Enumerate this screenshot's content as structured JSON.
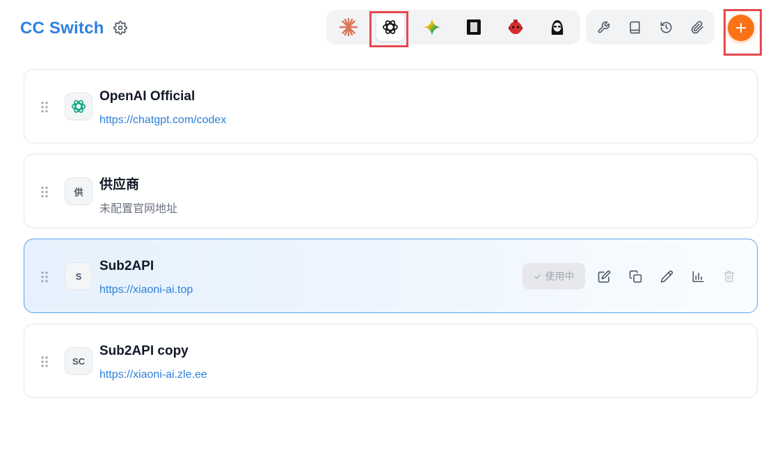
{
  "header": {
    "title": "CC Switch",
    "settings_icon": "gear-icon"
  },
  "app_switcher": [
    {
      "id": "claude",
      "icon": "claude-icon",
      "color": "#d97757",
      "active": false
    },
    {
      "id": "codex",
      "icon": "openai-icon",
      "color": "#111111",
      "active": true
    },
    {
      "id": "gemini",
      "icon": "gemini-icon",
      "color": "#4285f4",
      "active": false
    },
    {
      "id": "app4",
      "icon": "black-square-app-icon",
      "color": "#111111",
      "active": false
    },
    {
      "id": "app5",
      "icon": "red-mascot-icon",
      "color": "#d32f2f",
      "active": false
    },
    {
      "id": "app6",
      "icon": "character-avatar-icon",
      "color": "#111111",
      "active": false
    }
  ],
  "tools": [
    {
      "id": "tools",
      "icon": "wrench-icon"
    },
    {
      "id": "docs",
      "icon": "book-icon"
    },
    {
      "id": "history",
      "icon": "history-icon"
    },
    {
      "id": "attach",
      "icon": "paperclip-icon"
    }
  ],
  "add_button": {
    "icon": "plus-icon",
    "color": "#f97316"
  },
  "providers": [
    {
      "name": "OpenAI Official",
      "url": "https://chatgpt.com/codex",
      "avatar": "",
      "avatar_icon": "openai-icon",
      "url_muted": false,
      "active": false
    },
    {
      "name": "供应商",
      "url": "未配置官网地址",
      "avatar": "供",
      "url_muted": true,
      "active": false
    },
    {
      "name": "Sub2API",
      "url": "https://xiaoni-ai.top",
      "avatar": "S",
      "url_muted": false,
      "active": true
    },
    {
      "name": "Sub2API copy",
      "url": "https://xiaoni-ai.zle.ee",
      "avatar": "SC",
      "url_muted": false,
      "active": false
    }
  ],
  "active_actions": {
    "in_use_label": "使用中",
    "icons": [
      "edit-icon",
      "duplicate-icon",
      "pencil-icon",
      "usage-chart-icon",
      "trash-icon"
    ]
  },
  "colors": {
    "brand": "#2f7fe0",
    "link": "#2b7fd9",
    "active_border": "#5aa4ec",
    "highlight": "#e5484d"
  }
}
